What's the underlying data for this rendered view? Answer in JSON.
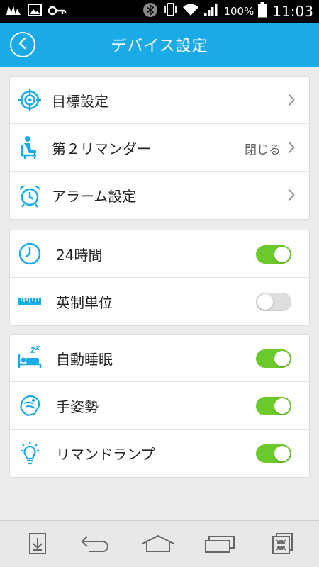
{
  "status_bar": {
    "battery_text": "100%",
    "time": "11:03"
  },
  "header": {
    "title": "デバイス設定",
    "back_icon": "back-circle-icon"
  },
  "groups": [
    {
      "items": [
        {
          "label": "目標設定",
          "icon": "target-icon",
          "control": "chevron"
        },
        {
          "label": "第２リマンダー",
          "icon": "sitting-person-icon",
          "control": "chevron",
          "value": "閉じる"
        },
        {
          "label": "アラーム設定",
          "icon": "alarm-clock-icon",
          "control": "chevron"
        }
      ]
    },
    {
      "items": [
        {
          "label": "24時間",
          "icon": "clock-icon",
          "control": "toggle",
          "on": true
        },
        {
          "label": "英制単位",
          "icon": "ruler-icon",
          "control": "toggle",
          "on": false
        }
      ]
    },
    {
      "items": [
        {
          "label": "自動睡眠",
          "icon": "sleep-icon",
          "control": "toggle",
          "on": true
        },
        {
          "label": "手姿勢",
          "icon": "hand-gesture-icon",
          "control": "toggle",
          "on": true
        },
        {
          "label": "リマンドランプ",
          "icon": "lamp-icon",
          "control": "toggle",
          "on": true
        }
      ]
    }
  ],
  "colors": {
    "accent": "#1aaae6",
    "toggle_on": "#6cc92c",
    "toggle_off": "#dedede",
    "background": "#ececec"
  },
  "nav_icons": [
    "download-icon",
    "back-arrow-icon",
    "home-icon",
    "recent-apps-icon",
    "screen-shrink-icon"
  ]
}
